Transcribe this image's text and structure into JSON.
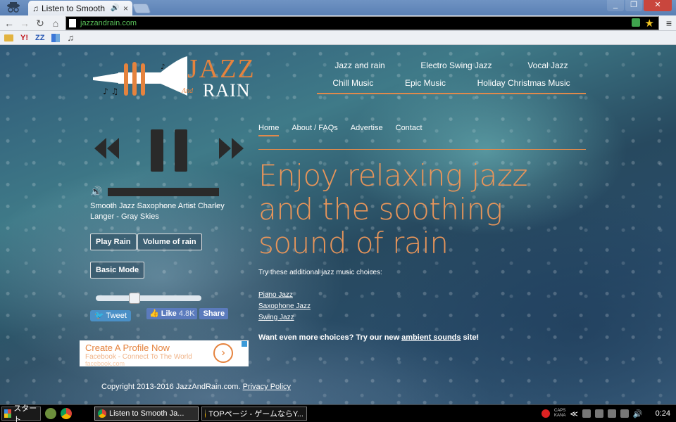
{
  "browser": {
    "tab_title": "Listen to Smooth",
    "url": "jazzandrain.com"
  },
  "logo": {
    "jazz": "JAZZ",
    "and": "And",
    "rain": "RAIN"
  },
  "topnav": {
    "row1": [
      "Jazz and rain",
      "Electro Swing Jazz",
      "Vocal Jazz"
    ],
    "row2": [
      "Chill Music",
      "Epic Music",
      "Holiday Christmas Music"
    ]
  },
  "player": {
    "track": "Smooth Jazz Saxophone Artist Charley Langer - Gray Skies",
    "play_rain": "Play Rain",
    "volume_of_rain": "Volume of rain",
    "basic_mode": "Basic Mode",
    "rain_volume_level": 0.35
  },
  "social": {
    "tweet": "Tweet",
    "like": "Like",
    "like_count": "4.8K",
    "share": "Share"
  },
  "ad": {
    "title": "Create A Profile Now",
    "subtitle": "Facebook - Connect To The World",
    "url": "facebook.com"
  },
  "subnav": [
    "Home",
    "About / FAQs",
    "Advertise",
    "Contact"
  ],
  "headline": "Enjoy relaxing jazz and the soothing sound of rain",
  "try_text": "Try these additional jazz music choices:",
  "links": [
    "Piano Jazz",
    "Saxophone Jazz",
    "Swing Jazz"
  ],
  "want": {
    "text": "Want even more choices? Try our new ",
    "ambient": "ambient sounds",
    "suffix": " site!"
  },
  "copyright": {
    "text": "Copyright 2013-2016 JazzAndRain.com.",
    "privacy": "Privacy Policy"
  },
  "taskbar": {
    "start": "スタート",
    "task1": "Listen to Smooth Ja...",
    "task2": "TOPページ - ゲームならY...",
    "caps": "CAPS",
    "kana": "KANA",
    "chevron": "≪",
    "clock": "0:24"
  },
  "colors": {
    "accent": "#e5833e",
    "text": "#ffffff"
  }
}
